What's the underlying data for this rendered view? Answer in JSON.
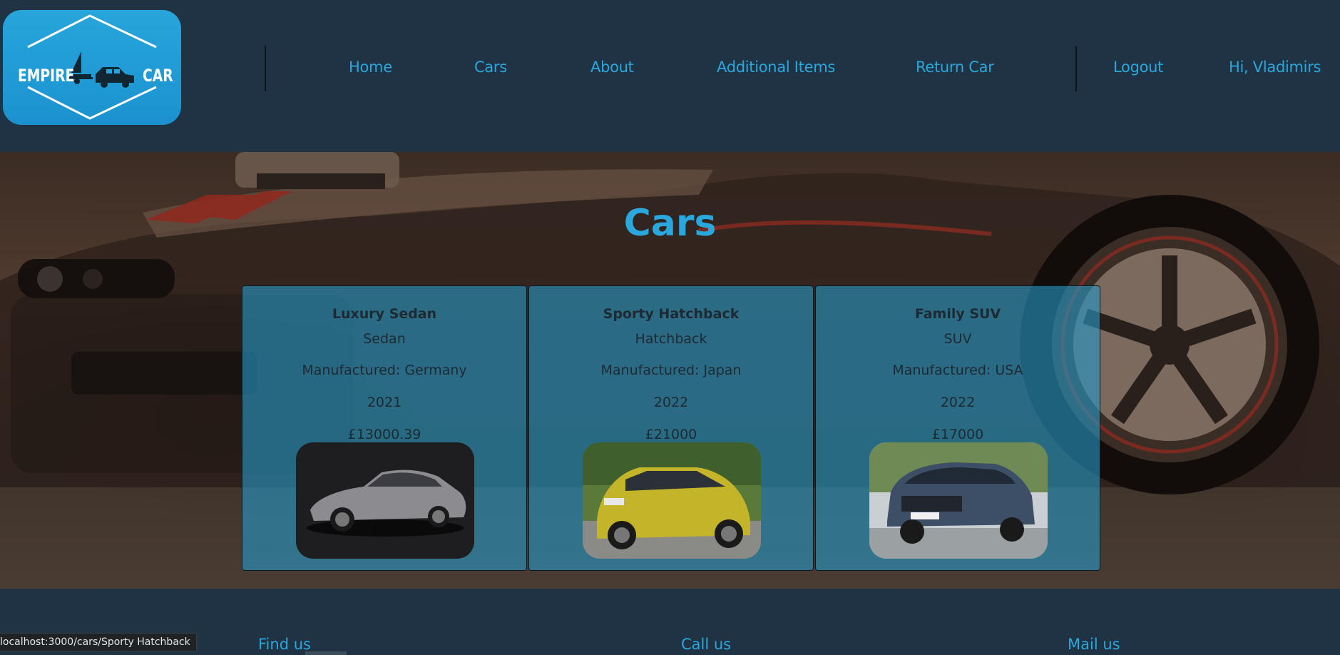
{
  "logo": {
    "left_text": "EMPIRE",
    "right_text": "CAR"
  },
  "nav": {
    "home": "Home",
    "cars": "Cars",
    "about": "About",
    "additional_items": "Additional Items",
    "return_car": "Return Car",
    "logout": "Logout",
    "greeting": "Hi, Vladimirs"
  },
  "hero": {
    "title": "Cars"
  },
  "cards": [
    {
      "name": "Luxury Sedan",
      "type": "Sedan",
      "manufactured": "Manufactured: Germany",
      "year": "2021",
      "price": "£13000.39",
      "image_icon": "silver-sedan-photo"
    },
    {
      "name": "Sporty Hatchback",
      "type": "Hatchback",
      "manufactured": "Manufactured: Japan",
      "year": "2022",
      "price": "£21000",
      "image_icon": "yellow-hatchback-photo"
    },
    {
      "name": "Family SUV",
      "type": "SUV",
      "manufactured": "Manufactured: USA",
      "year": "2022",
      "price": "£17000",
      "image_icon": "blue-suv-photo"
    }
  ],
  "footer": {
    "find": "Find us",
    "call": "Call us",
    "mail": "Mail us"
  },
  "status_bar": {
    "url": "localhost:3000/cars/Sporty Hatchback"
  },
  "colors": {
    "accent": "#2aa7dd",
    "background": "#1f3344",
    "card": "#2696c3"
  }
}
